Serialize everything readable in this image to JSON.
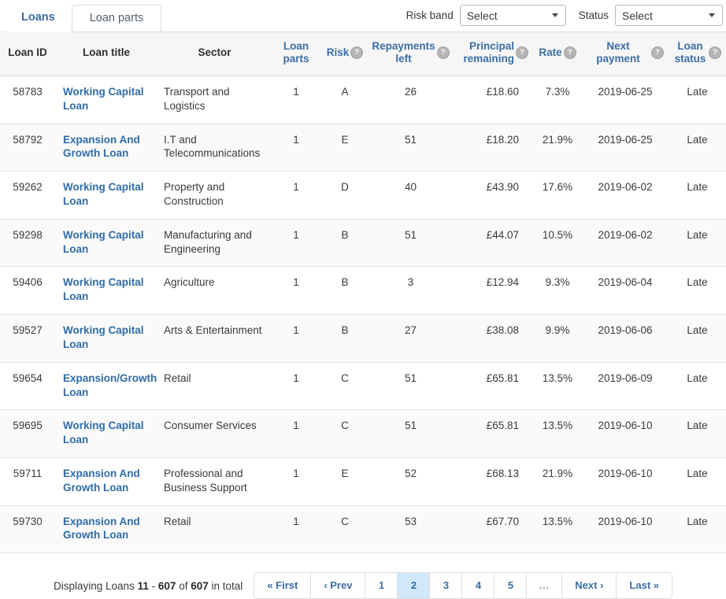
{
  "tabs": [
    {
      "label": "Loans",
      "active": true
    },
    {
      "label": "Loan parts",
      "active": false
    }
  ],
  "filters": {
    "risk_band": {
      "label": "Risk band",
      "value": "Select"
    },
    "status": {
      "label": "Status",
      "value": "Select"
    }
  },
  "table": {
    "columns": [
      {
        "label": "Loan ID",
        "sortable": false,
        "help": false,
        "key": "id"
      },
      {
        "label": "Loan title",
        "sortable": false,
        "help": false,
        "key": "title"
      },
      {
        "label": "Sector",
        "sortable": false,
        "help": false,
        "key": "sector"
      },
      {
        "label": "Loan parts",
        "sortable": true,
        "help": false,
        "key": "parts"
      },
      {
        "label": "Risk",
        "sortable": true,
        "help": true,
        "key": "risk"
      },
      {
        "label": "Repayments left",
        "sortable": true,
        "help": true,
        "key": "repayments_left"
      },
      {
        "label": "Principal remaining",
        "sortable": true,
        "help": true,
        "key": "principal_remaining"
      },
      {
        "label": "Rate",
        "sortable": true,
        "help": true,
        "key": "rate"
      },
      {
        "label": "Next payment",
        "sortable": true,
        "help": true,
        "key": "next_payment"
      },
      {
        "label": "Loan status",
        "sortable": true,
        "help": true,
        "key": "loan_status"
      }
    ],
    "help_glyph": "?",
    "rows": [
      {
        "id": "58783",
        "title": "Working Capital Loan",
        "sector": "Transport and Logistics",
        "parts": "1",
        "risk": "A",
        "repayments_left": "26",
        "principal_remaining": "£18.60",
        "rate": "7.3%",
        "next_payment": "2019-06-25",
        "loan_status": "Late"
      },
      {
        "id": "58792",
        "title": "Expansion And Growth Loan",
        "sector": "I.T and Telecommunications",
        "parts": "1",
        "risk": "E",
        "repayments_left": "51",
        "principal_remaining": "£18.20",
        "rate": "21.9%",
        "next_payment": "2019-06-25",
        "loan_status": "Late"
      },
      {
        "id": "59262",
        "title": "Working Capital Loan",
        "sector": "Property and Construction",
        "parts": "1",
        "risk": "D",
        "repayments_left": "40",
        "principal_remaining": "£43.90",
        "rate": "17.6%",
        "next_payment": "2019-06-02",
        "loan_status": "Late"
      },
      {
        "id": "59298",
        "title": "Working Capital Loan",
        "sector": "Manufacturing and Engineering",
        "parts": "1",
        "risk": "B",
        "repayments_left": "51",
        "principal_remaining": "£44.07",
        "rate": "10.5%",
        "next_payment": "2019-06-02",
        "loan_status": "Late"
      },
      {
        "id": "59406",
        "title": "Working Capital Loan",
        "sector": "Agriculture",
        "parts": "1",
        "risk": "B",
        "repayments_left": "3",
        "principal_remaining": "£12.94",
        "rate": "9.3%",
        "next_payment": "2019-06-04",
        "loan_status": "Late"
      },
      {
        "id": "59527",
        "title": "Working Capital Loan",
        "sector": "Arts & Entertainment",
        "parts": "1",
        "risk": "B",
        "repayments_left": "27",
        "principal_remaining": "£38.08",
        "rate": "9.9%",
        "next_payment": "2019-06-06",
        "loan_status": "Late"
      },
      {
        "id": "59654",
        "title": "Expansion/Growth Loan",
        "sector": "Retail",
        "parts": "1",
        "risk": "C",
        "repayments_left": "51",
        "principal_remaining": "£65.81",
        "rate": "13.5%",
        "next_payment": "2019-06-09",
        "loan_status": "Late"
      },
      {
        "id": "59695",
        "title": "Working Capital Loan",
        "sector": "Consumer Services",
        "parts": "1",
        "risk": "C",
        "repayments_left": "51",
        "principal_remaining": "£65.81",
        "rate": "13.5%",
        "next_payment": "2019-06-10",
        "loan_status": "Late"
      },
      {
        "id": "59711",
        "title": "Expansion And Growth Loan",
        "sector": "Professional and Business Support",
        "parts": "1",
        "risk": "E",
        "repayments_left": "52",
        "principal_remaining": "£68.13",
        "rate": "21.9%",
        "next_payment": "2019-06-10",
        "loan_status": "Late"
      },
      {
        "id": "59730",
        "title": "Expansion And Growth Loan",
        "sector": "Retail",
        "parts": "1",
        "risk": "C",
        "repayments_left": "53",
        "principal_remaining": "£67.70",
        "rate": "13.5%",
        "next_payment": "2019-06-10",
        "loan_status": "Late"
      }
    ]
  },
  "footer": {
    "displaying_prefix": "Displaying Loans",
    "range_start": "11",
    "range_separator": "-",
    "range_end": "607",
    "of_word": "of",
    "total": "607",
    "suffix": "in total",
    "pagination": [
      {
        "label": "« First",
        "type": "wide",
        "active": false
      },
      {
        "label": "‹ Prev",
        "type": "wide",
        "active": false
      },
      {
        "label": "1",
        "type": "num",
        "active": false
      },
      {
        "label": "2",
        "type": "num",
        "active": true
      },
      {
        "label": "3",
        "type": "num",
        "active": false
      },
      {
        "label": "4",
        "type": "num",
        "active": false
      },
      {
        "label": "5",
        "type": "num",
        "active": false
      },
      {
        "label": "...",
        "type": "ellipsis",
        "active": false
      },
      {
        "label": "Next ›",
        "type": "wide",
        "active": false
      },
      {
        "label": "Last »",
        "type": "wide",
        "active": false
      }
    ]
  },
  "colors": {
    "link": "#2f6ca8",
    "header_link": "#3b6ea5",
    "active_page_bg": "#cfe8fb",
    "header_bg": "#f6f6f6",
    "row_alt_bg": "#fafafa"
  }
}
